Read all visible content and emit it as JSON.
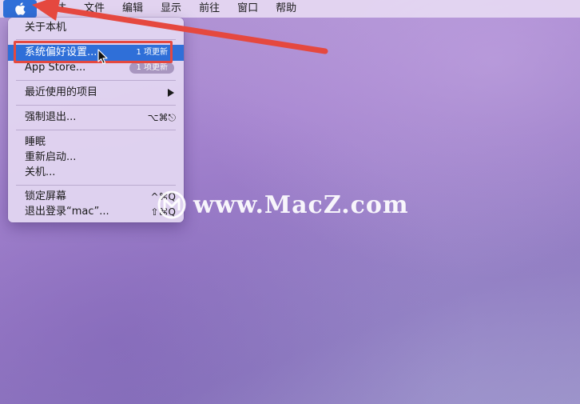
{
  "menubar": {
    "items": [
      {
        "label": "访达"
      },
      {
        "label": "文件"
      },
      {
        "label": "编辑"
      },
      {
        "label": "显示"
      },
      {
        "label": "前往"
      },
      {
        "label": "窗口"
      },
      {
        "label": "帮助"
      }
    ]
  },
  "apple_menu": {
    "about": "关于本机",
    "system_preferences": "系统偏好设置...",
    "system_preferences_badge": "1 项更新",
    "app_store": "App Store...",
    "app_store_badge": "1 项更新",
    "recent_items": "最近使用的项目",
    "force_quit": "强制退出...",
    "force_quit_shortcut": "⌥⌘⎋",
    "sleep": "睡眠",
    "restart": "重新启动...",
    "shutdown": "关机...",
    "lock_screen": "锁定屏幕",
    "lock_screen_shortcut": "^⌘Q",
    "logout": "退出登录“mac”...",
    "logout_shortcut": "⇧⌘Q"
  },
  "watermark": {
    "text": "www.MacZ.com"
  },
  "colors": {
    "highlight": "#2f6fd8",
    "annotation_red": "#e5483f",
    "menu_background": "#e1d4f0"
  }
}
